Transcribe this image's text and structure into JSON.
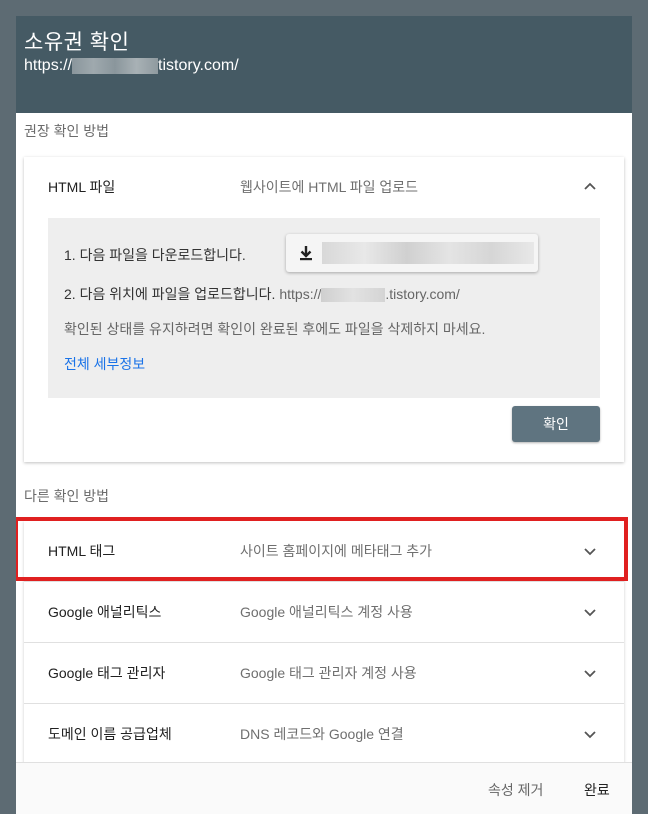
{
  "dialog": {
    "title": "소유권 확인",
    "url_prefix": "https://",
    "url_suffix": "tistory.com/"
  },
  "recommended": {
    "section_label": "권장 확인 방법",
    "method_name": "HTML 파일",
    "method_desc": "웹사이트에 HTML 파일 업로드",
    "step1": "1. 다음 파일을 다운로드합니다.",
    "step2": "2. 다음 위치에 파일을 업로드합니다.",
    "step2_url_prefix": "https://",
    "step2_url_suffix": ".tistory.com/",
    "note": "확인된 상태를 유지하려면 확인이 완료된 후에도 파일을 삭제하지 마세요.",
    "details_link": "전체 세부정보",
    "confirm_label": "확인"
  },
  "other": {
    "section_label": "다른 확인 방법",
    "methods": [
      {
        "name": "HTML 태그",
        "desc": "사이트 홈페이지에 메타태그 추가"
      },
      {
        "name": "Google 애널리틱스",
        "desc": "Google 애널리틱스 계정 사용"
      },
      {
        "name": "Google 태그 관리자",
        "desc": "Google 태그 관리자 계정 사용"
      },
      {
        "name": "도메인 이름 공급업체",
        "desc": "DNS 레코드와 Google 연결"
      }
    ]
  },
  "footer": {
    "remove_label": "속성 제거",
    "done_label": "완료"
  },
  "colors": {
    "header_bg": "#455a64",
    "highlight_border": "#e02020",
    "link": "#1a73e8",
    "confirm_bg": "#5f7480"
  },
  "icons": {
    "collapse": "chevron-up-icon",
    "expand": "chevron-down-icon",
    "download": "download-icon"
  }
}
